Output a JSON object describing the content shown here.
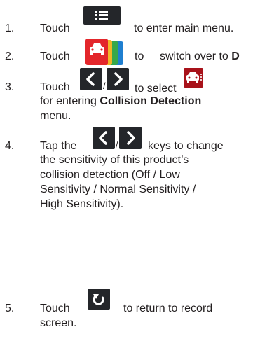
{
  "steps": [
    {
      "number": "1.",
      "before": "Touch",
      "after": "to enter main menu.",
      "icon": "menu-list-icon"
    },
    {
      "number": "2.",
      "before": "Touch",
      "mid": "to",
      "after": "switch over to",
      "after_bold": "D",
      "icon": "car-settings-tab-icon"
    },
    {
      "number": "3.",
      "before": "Touch",
      "sep": "/",
      "mid": "to select",
      "line2_before": "for entering",
      "line2_bold": "Collision Detection",
      "line3": "menu.",
      "icons": [
        "chevron-left-icon",
        "chevron-right-icon",
        "car-collision-icon"
      ]
    },
    {
      "number": "4.",
      "before": "Tap the",
      "sep": "/",
      "after": "keys to change",
      "line2": "the sensitivity of this product’s",
      "line3": "collision detection (Off / Low",
      "line4": "Sensitivity / Normal Sensitivity /",
      "line5": "High Sensitivity).",
      "icons": [
        "chevron-left-icon",
        "chevron-right-icon"
      ]
    },
    {
      "number": "5.",
      "before": "Touch",
      "after": "to  return  to  record",
      "line2": "screen.",
      "icon": "return-icon"
    }
  ],
  "colors": {
    "text": "#231f20",
    "button_dark": "#24262a",
    "tab_red": "#e3262b",
    "tab_yellow": "#f2b527",
    "tab_green": "#37a84a",
    "tab_blue": "#1f7fd0",
    "collision_icon_red": "#a8121a"
  }
}
